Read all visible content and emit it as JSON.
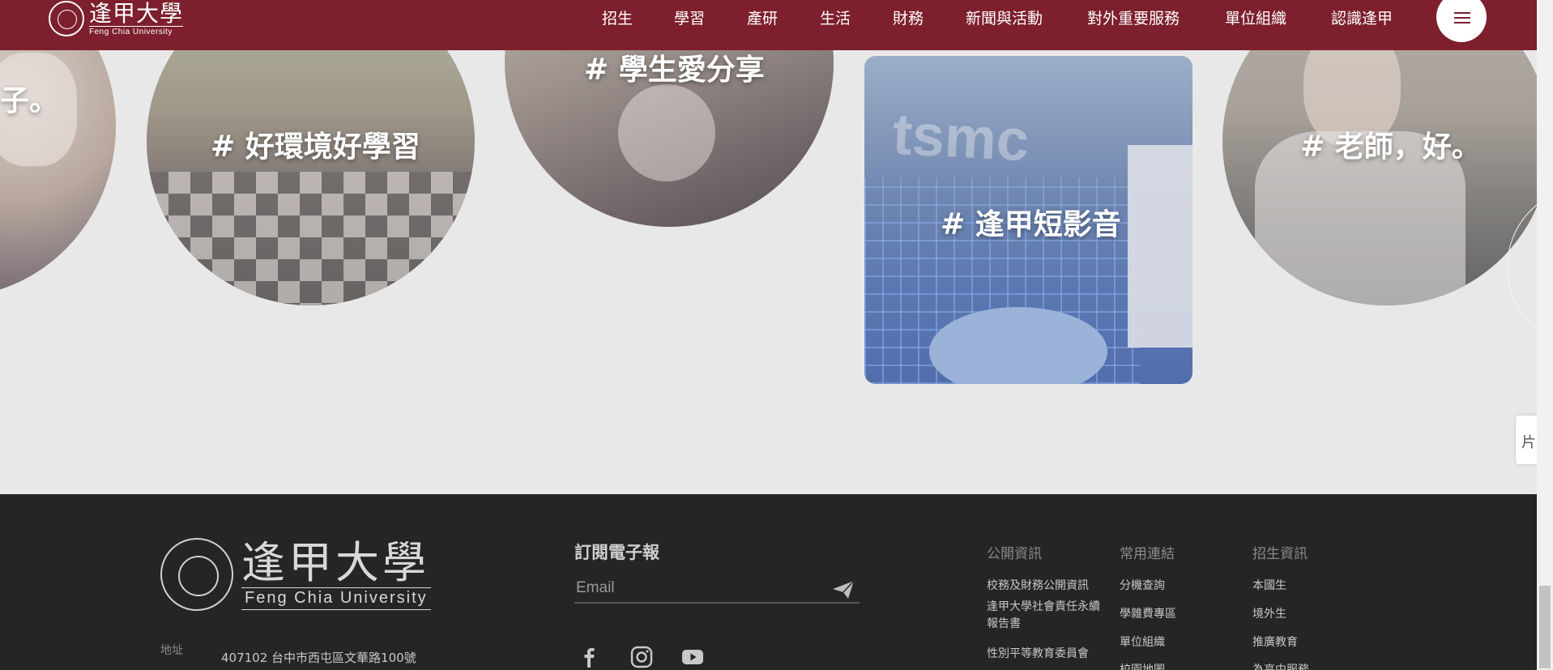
{
  "header": {
    "logo_cn": "逢甲大學",
    "logo_en": "Feng Chia University",
    "nav": [
      "招生",
      "學習",
      "產研",
      "生活",
      "財務",
      "新聞與活動",
      "對外重要服務",
      "單位組織",
      "認識逢甲"
    ],
    "menu_icon": "hamburger-icon"
  },
  "gallery": {
    "tags": [
      "子。",
      "# 好環境好學習",
      "# 學生愛分享",
      "# 逢甲短影音",
      "# 老師，好。"
    ]
  },
  "side_tab": {
    "label": "片"
  },
  "footer": {
    "logo_cn": "逢甲大學",
    "logo_en": "Feng Chia University",
    "address_label": "地址",
    "address": "407102 台中市西屯區文華路100號",
    "newsletter": {
      "title": "訂閱電子報",
      "placeholder": "Email",
      "send_icon": "paper-plane-icon"
    },
    "social_icons": [
      "facebook-icon",
      "instagram-icon",
      "youtube-icon"
    ],
    "columns": [
      {
        "title": "公開資訊",
        "links": [
          "校務及財務公開資訊",
          "逢甲大學社會責任永續",
          "報告書",
          "性別平等教育委員會"
        ]
      },
      {
        "title": "常用連結",
        "links": [
          "分機查詢",
          "學雜費專區",
          "單位組織",
          "校園地圖"
        ]
      },
      {
        "title": "招生資訊",
        "links": [
          "本國生",
          "境外生",
          "推廣教育",
          "為高中服務"
        ]
      }
    ]
  },
  "colors": {
    "brand": "#7d1f2d",
    "footer_bg": "#252525",
    "gallery_bg": "#e8e8e8"
  }
}
